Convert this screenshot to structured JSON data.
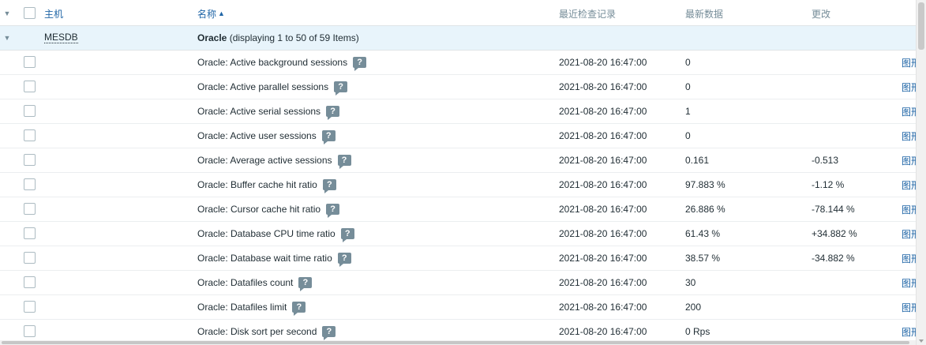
{
  "header": {
    "host": "主机",
    "name": "名称",
    "sort_indicator": "▲",
    "last_check": "最近检查记录",
    "latest_data": "最新数据",
    "change": "更改"
  },
  "group": {
    "host": "MESDB",
    "name": "Oracle",
    "info": " (displaying 1 to 50 of 59 Items)"
  },
  "icons": {
    "toggle": "▼",
    "help": "?"
  },
  "rows": [
    {
      "name": "Oracle: Active background sessions",
      "time": "2021-08-20 16:47:00",
      "value": "0",
      "change": "",
      "link": "图形"
    },
    {
      "name": "Oracle: Active parallel sessions",
      "time": "2021-08-20 16:47:00",
      "value": "0",
      "change": "",
      "link": "图形"
    },
    {
      "name": "Oracle: Active serial sessions",
      "time": "2021-08-20 16:47:00",
      "value": "1",
      "change": "",
      "link": "图形"
    },
    {
      "name": "Oracle: Active user sessions",
      "time": "2021-08-20 16:47:00",
      "value": "0",
      "change": "",
      "link": "图形"
    },
    {
      "name": "Oracle: Average active sessions",
      "time": "2021-08-20 16:47:00",
      "value": "0.161",
      "change": "-0.513",
      "link": "图形"
    },
    {
      "name": "Oracle: Buffer cache hit ratio",
      "time": "2021-08-20 16:47:00",
      "value": "97.883 %",
      "change": "-1.12 %",
      "link": "图形"
    },
    {
      "name": "Oracle: Cursor cache hit ratio",
      "time": "2021-08-20 16:47:00",
      "value": "26.886 %",
      "change": "-78.144 %",
      "link": "图形"
    },
    {
      "name": "Oracle: Database CPU time ratio",
      "time": "2021-08-20 16:47:00",
      "value": "61.43 %",
      "change": "+34.882 %",
      "link": "图形"
    },
    {
      "name": "Oracle: Database wait time ratio",
      "time": "2021-08-20 16:47:00",
      "value": "38.57 %",
      "change": "-34.882 %",
      "link": "图形"
    },
    {
      "name": "Oracle: Datafiles count",
      "time": "2021-08-20 16:47:00",
      "value": "30",
      "change": "",
      "link": "图形"
    },
    {
      "name": "Oracle: Datafiles limit",
      "time": "2021-08-20 16:47:00",
      "value": "200",
      "change": "",
      "link": "图形"
    },
    {
      "name": "Oracle: Disk sort per second",
      "time": "2021-08-20 16:47:00",
      "value": "0 Rps",
      "change": "",
      "link": "图形"
    }
  ]
}
